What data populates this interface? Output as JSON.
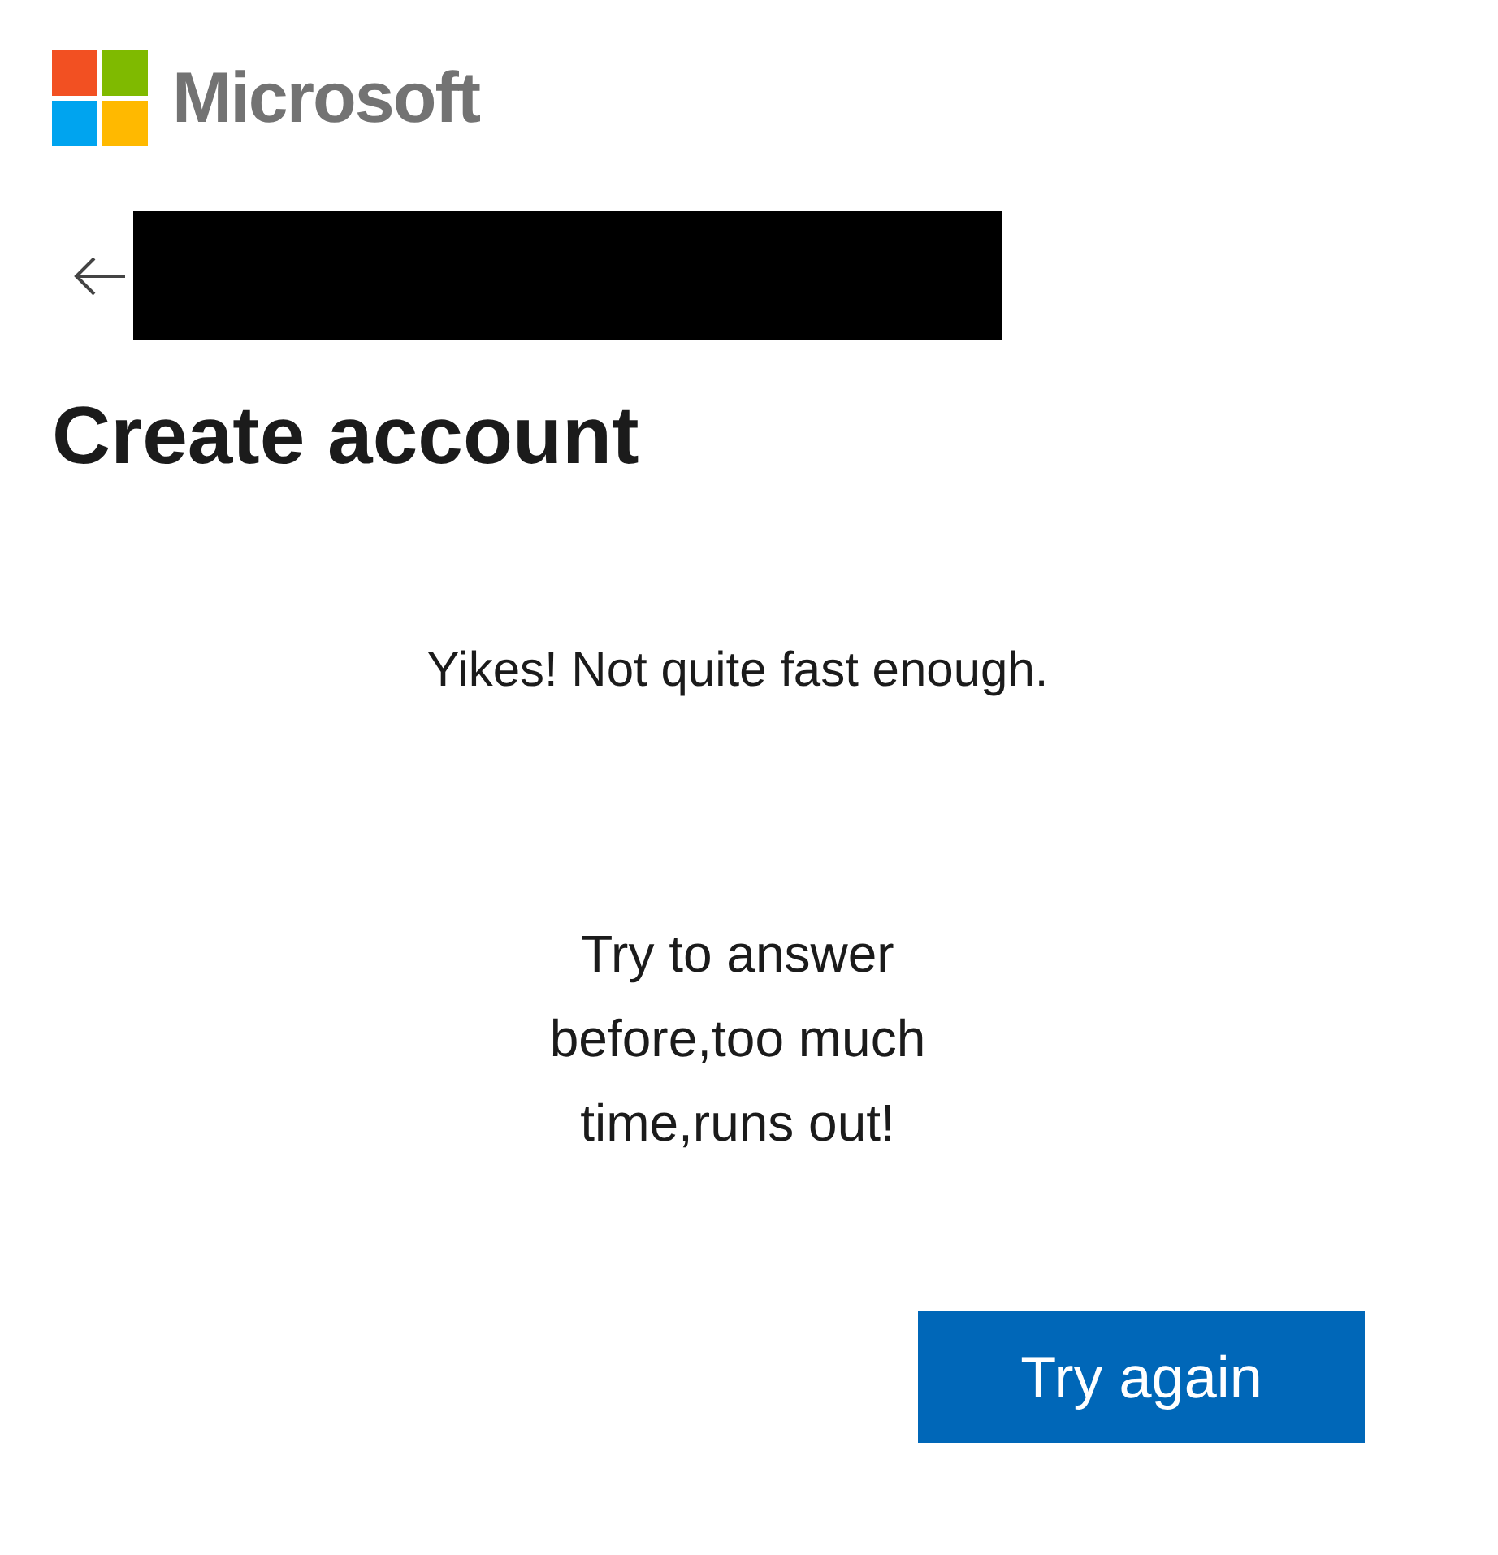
{
  "logo": {
    "text": "Microsoft"
  },
  "title": "Create account",
  "message": "Yikes! Not quite fast enough.",
  "hint": "Try to answer before,too much time,runs out!",
  "button": {
    "label": "Try again"
  }
}
